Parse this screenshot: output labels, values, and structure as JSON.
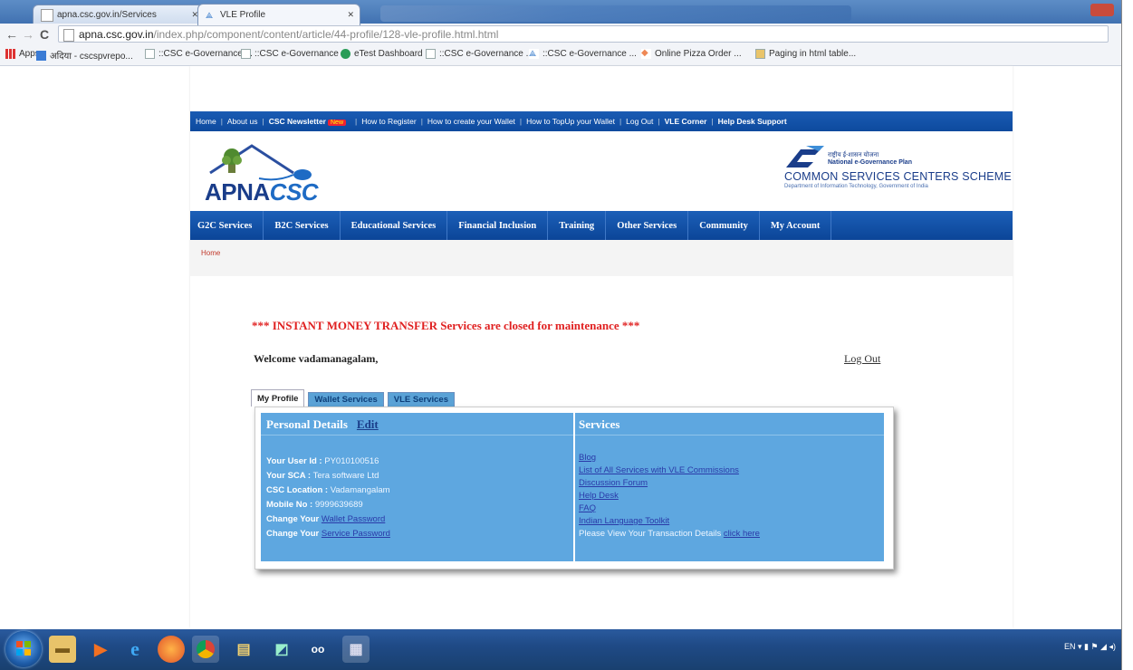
{
  "browser": {
    "tabs": [
      {
        "label": "apna.csc.gov.in/Services"
      },
      {
        "label": "VLE Profile"
      }
    ],
    "url": {
      "host": "apna.csc.gov.in",
      "path": "/index.php/component/content/article/44-profile/128-vle-profile.html.html"
    },
    "bookmarks": [
      {
        "label": "Apps"
      },
      {
        "label": "अदिया - cscspvrepo..."
      },
      {
        "label": "::CSC e-Governance ..."
      },
      {
        "label": "::CSC e-Governance ..."
      },
      {
        "label": "eTest Dashboard"
      },
      {
        "label": "::CSC e-Governance ..."
      },
      {
        "label": "::CSC e-Governance ..."
      },
      {
        "label": "Online Pizza Order ..."
      },
      {
        "label": "Paging in html table..."
      }
    ]
  },
  "topnav": {
    "home": "Home",
    "about": "About us",
    "newsletter": "CSC Newsletter",
    "new_badge": "New",
    "register": "How to Register",
    "create_wallet": "How to create your Wallet",
    "topup": "How to TopUp your Wallet",
    "logout": "Log Out",
    "vle_corner": "VLE Corner",
    "help": "Help Desk Support"
  },
  "header": {
    "logo_apna": "APNA",
    "logo_csc": "CSC",
    "nge_hindi": "राष्ट्रीय ई-शासन योजना",
    "nge_en": "National e-Governance Plan",
    "scheme": "COMMON SERVICES CENTERS SCHEME",
    "dept": "Department of Information Technology, Government of India"
  },
  "mainnav": [
    {
      "label": "G2C Services"
    },
    {
      "label": "B2C Services"
    },
    {
      "label": "Educational Services"
    },
    {
      "label": "Financial Inclusion"
    },
    {
      "label": "Training"
    },
    {
      "label": "Other Services"
    },
    {
      "label": "Community"
    },
    {
      "label": "My Account"
    }
  ],
  "breadcrumb": "Home",
  "notice": "*** INSTANT MONEY TRANSFER Services are closed for maintenance ***",
  "welcome": "Welcome vadamanagalam,",
  "logout_link": "Log Out",
  "profile_tabs": [
    {
      "label": "My Profile",
      "active": true
    },
    {
      "label": "Wallet Services",
      "active": false
    },
    {
      "label": "VLE Services",
      "active": false
    }
  ],
  "personal": {
    "title": "Personal Details",
    "edit": "Edit",
    "user_id_label": "Your User Id :",
    "user_id": "PY010100516",
    "sca_label": "Your SCA :",
    "sca": "Tera software Ltd",
    "location_label": "CSC Location :",
    "location": "Vadamangalam",
    "mobile_label": "Mobile No :",
    "mobile": "9999639689",
    "change1_label": "Change Your",
    "change1_link": "Wallet Password",
    "change2_label": "Change Your",
    "change2_link": "Service Password"
  },
  "services": {
    "title": "Services",
    "links": [
      "Blog",
      "List of All Services with VLE Commissions",
      "Discussion Forum",
      "Help Desk",
      "FAQ",
      "Indian Language Toolkit"
    ],
    "txn_text": "Please View Your Transaction Details",
    "txn_link": "click here"
  },
  "taskbar": {
    "tray": "EN"
  }
}
